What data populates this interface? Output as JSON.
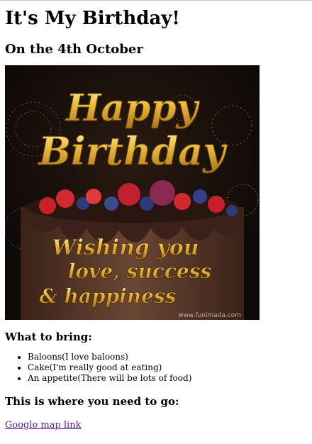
{
  "page": {
    "title": "It's My Birthday!",
    "date_heading": "On the 4th October"
  },
  "image": {
    "line1": "Happy",
    "line2": "Birthday",
    "wish1": "Wishing you",
    "wish2": "love, success",
    "wish3": "& happiness",
    "watermark": "www.funimada.com",
    "colors": {
      "background": "#120d0b",
      "gold": "#e8b83a",
      "cake": "#5a3a2c",
      "frosting": "#3b2119"
    }
  },
  "bring": {
    "heading": "What to bring:",
    "items": [
      "Baloons(I love baloons)",
      "Cake(I'm really good at eating)",
      "An appetite(There will be lots of food)"
    ]
  },
  "location": {
    "heading": "This is where you need to go:",
    "link_label": "Google map link"
  }
}
